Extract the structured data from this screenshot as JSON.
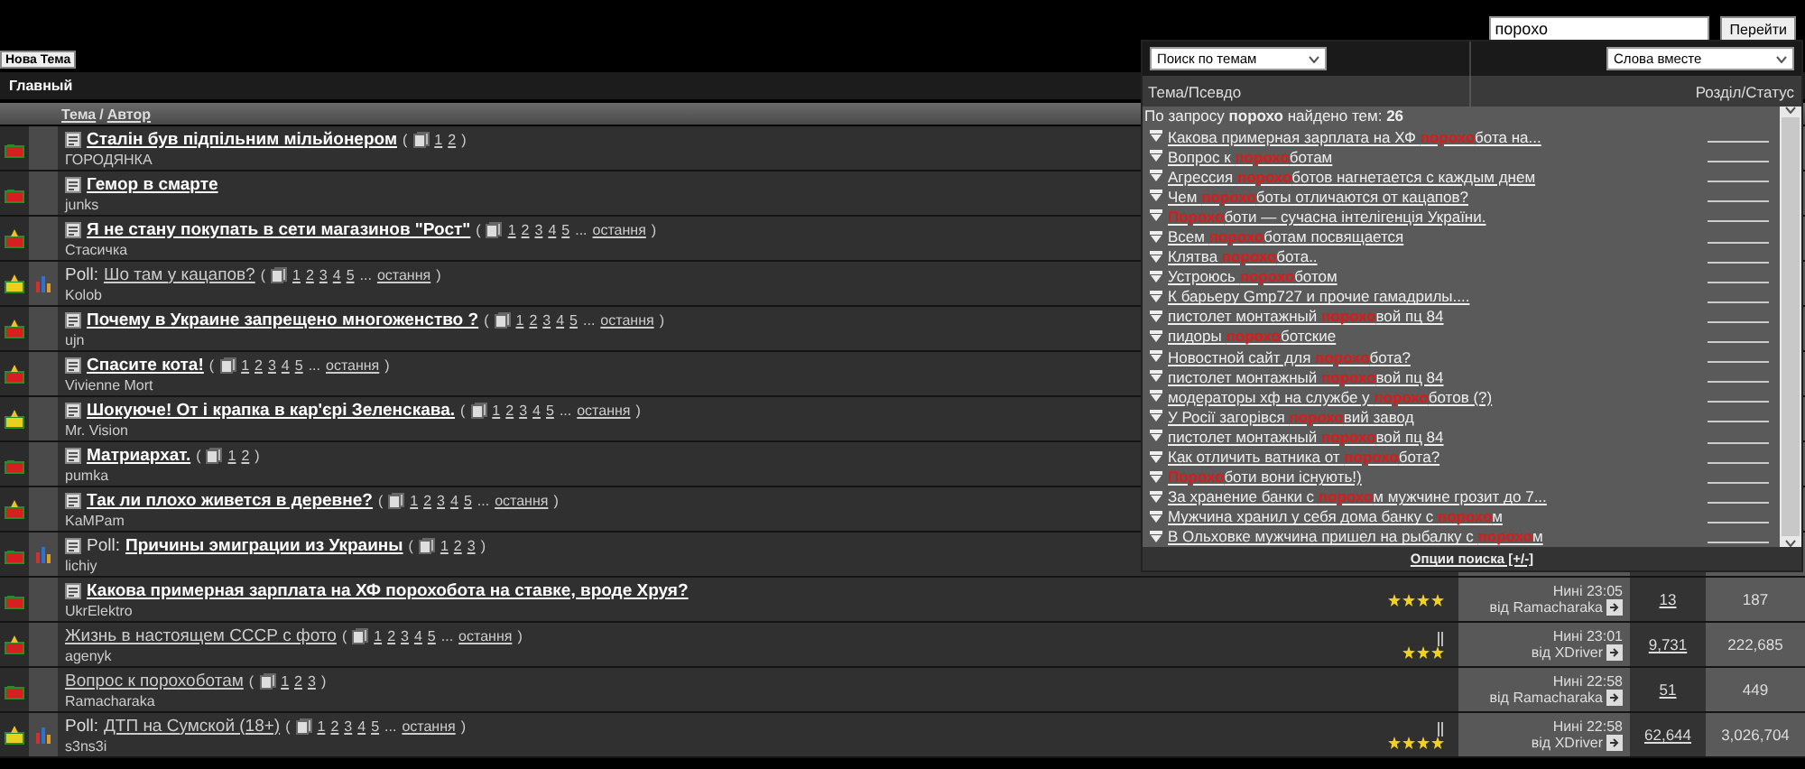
{
  "search": {
    "value": "порохо",
    "button": "Перейти"
  },
  "new_topic_button": "Нова Тема",
  "breadcrumb": "Главный",
  "table": {
    "header": {
      "topic": "Тема",
      "separator": "/",
      "author": "Автор"
    },
    "rows": [
      {
        "icon": {
          "color": "#d42020",
          "hot": false
        },
        "poll": false,
        "featured": true,
        "title": "Сталін був підпільним мільйонером",
        "open": "(",
        "pages": [
          "1",
          "2"
        ],
        "close": ")",
        "author": "ГОРОДЯНКА",
        "attachment": false
      },
      {
        "icon": {
          "color": "#d42020",
          "hot": false
        },
        "poll": false,
        "featured": true,
        "title": "Гемор в смарте",
        "pages": [],
        "author": "junks",
        "attachment": false
      },
      {
        "icon": {
          "color": "#d42020",
          "hot": true
        },
        "poll": false,
        "featured": true,
        "title": "Я не стану покупать в сети магазинов \"Рост\"",
        "open": "(",
        "close": ")",
        "pages": [
          "1",
          "2",
          "3",
          "4",
          "5"
        ],
        "more": "...",
        "last": "остання",
        "author": "Стасичка",
        "attachment": false
      },
      {
        "icon": {
          "color": "#e8d020",
          "hot": true
        },
        "poll": true,
        "prefix": "Poll:",
        "featured": false,
        "title": "Шо там у кацапов?",
        "open": "(",
        "close": ")",
        "pages": [
          "1",
          "2",
          "3",
          "4",
          "5"
        ],
        "more": "...",
        "last": "остання",
        "author": "Kolob",
        "attachment": false
      },
      {
        "icon": {
          "color": "#d42020",
          "hot": true
        },
        "poll": false,
        "featured": true,
        "title": "Почему в Украине запрещено многоженство ?",
        "open": "(",
        "close": ")",
        "pages": [
          "1",
          "2",
          "3",
          "4",
          "5"
        ],
        "more": "...",
        "last": "остання",
        "author": "ujn",
        "attachment": false
      },
      {
        "icon": {
          "color": "#d42020",
          "hot": true
        },
        "poll": false,
        "featured": true,
        "title": "Спасите кота!",
        "open": "(",
        "close": ")",
        "pages": [
          "1",
          "2",
          "3",
          "4",
          "5"
        ],
        "more": "...",
        "last": "остання",
        "author": "Vivienne Mort",
        "attachment": false
      },
      {
        "icon": {
          "color": "#e8d020",
          "hot": true
        },
        "poll": false,
        "featured": true,
        "title": "Шокуюче! От і крапка в кар'єрі Зеленскава.",
        "open": "(",
        "close": ")",
        "pages": [
          "1",
          "2",
          "3",
          "4",
          "5"
        ],
        "more": "...",
        "last": "остання",
        "author": "Mr. Vision",
        "attachment": false
      },
      {
        "icon": {
          "color": "#d42020",
          "hot": false
        },
        "poll": false,
        "featured": true,
        "title": "Матриархат.",
        "open": "(",
        "close": ")",
        "pages": [
          "1",
          "2"
        ],
        "author": "pumka",
        "attachment": false
      },
      {
        "icon": {
          "color": "#d42020",
          "hot": true
        },
        "poll": false,
        "featured": true,
        "title": "Так ли плохо живется в деревне?",
        "open": "(",
        "close": ")",
        "pages": [
          "1",
          "2",
          "3",
          "4",
          "5"
        ],
        "more": "...",
        "last": "остання",
        "author": "KaMPam",
        "attachment": false
      },
      {
        "icon": {
          "color": "#d42020",
          "hot": false
        },
        "poll": true,
        "prefix": "Poll:",
        "featured": true,
        "title": "Причины эмиграции из Украины",
        "open": "(",
        "close": ")",
        "pages": [
          "1",
          "2",
          "3"
        ],
        "author": "lichiy",
        "attachment": false
      },
      {
        "icon": {
          "color": "#d42020",
          "hot": false
        },
        "poll": false,
        "featured": true,
        "title": "Какова примерная зарплата на ХФ порохобота на ставке, вроде Хруя?",
        "pages": [],
        "author": "UkrElektro",
        "stars": 4,
        "attachment": false,
        "last_post": {
          "time": "Нині 23:05",
          "by": "від Ramacharaka"
        },
        "replies": "13",
        "views": "187"
      },
      {
        "icon": {
          "color": "#d42020",
          "hot": true
        },
        "poll": false,
        "featured": false,
        "title": "Жизнь в настоящем СССР с фото",
        "open": "(",
        "close": ")",
        "pages": [
          "1",
          "2",
          "3",
          "4",
          "5"
        ],
        "more": "...",
        "last": "остання",
        "author": "agenyk",
        "stars": 3,
        "attachment": true,
        "last_post": {
          "time": "Нині 23:01",
          "by": "від XDriver"
        },
        "replies": "9,731",
        "views": "222,685"
      },
      {
        "icon": {
          "color": "#d42020",
          "hot": false
        },
        "poll": false,
        "featured": false,
        "title": "Вопрос к порохоботам",
        "open": "(",
        "close": ")",
        "pages": [
          "1",
          "2",
          "3"
        ],
        "author": "Ramacharaka",
        "attachment": false,
        "last_post": {
          "time": "Нині 22:58",
          "by": "від Ramacharaka"
        },
        "replies": "51",
        "views": "449"
      },
      {
        "icon": {
          "color": "#e8d020",
          "hot": true
        },
        "poll": true,
        "prefix": "Poll:",
        "featured": false,
        "title": "ДТП на Сумской (18+)",
        "open": "(",
        "close": ")",
        "pages": [
          "1",
          "2",
          "3",
          "4",
          "5"
        ],
        "more": "...",
        "last": "остання",
        "author": "s3ns3i",
        "stars": 4,
        "attachment": true,
        "last_post": {
          "time": "Нині 22:58",
          "by": "від XDriver"
        },
        "replies": "62,644",
        "views": "3,026,704"
      }
    ]
  },
  "search_popup": {
    "scope_select": "Поиск по темам",
    "mode_select": "Слова вместе",
    "col_topic": "Тема/Псевдо",
    "col_section": "Розділ/Статус",
    "summary": "По запросу **порохо** найдено тем: **26**",
    "results": [
      "Какова примерная зарплата на ХФ **порохо**бота на...",
      "Вопрос к **порохо**ботам",
      "Агрессия **порохо**ботов нагнетается с каждым днем",
      "Чем **порохо**боты отличаются от кацапов?",
      "**Порохо**боти — сучасна інтелігенція України.",
      "Всем **порохо**ботам посвящается",
      "Клятва **порохо**бота..",
      "Устроюсь **порохо**ботом",
      "К барьеру Gmp727 и прочие гамадрилы....",
      "пистолет монтажный **порохо**вой пц 84",
      "пидоры **порохо**ботские",
      "Новостной сайт для **порохо**бота?",
      "пистолет монтажный **порохо**вой пц 84",
      "модераторы хф на службе у **порохо**ботов (?)",
      "У Росії загорівся **порохо**вий завод",
      "пистолет монтажный **порохо**вой пц 84",
      "Как отличить ватника от **порохо**бота?",
      "**Порохо**боти вони існують!)",
      "За хранение банки с **порохо**м мужчине грозит до 7...",
      "Мужчина хранил у себя дома банку с **порохо**м",
      "В Ольховке мужчина пришел на рыбалку с **порохо**м"
    ],
    "options_link": "Опции поиска [+/-]"
  }
}
